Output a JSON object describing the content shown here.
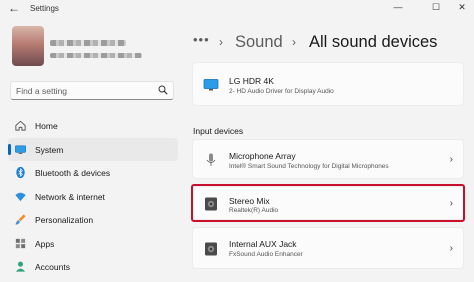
{
  "window": {
    "title": "Settings",
    "back_glyph": "←",
    "minimize_glyph": "—",
    "maximize_glyph": "☐",
    "close_glyph": "✕"
  },
  "search": {
    "placeholder": "Find a setting"
  },
  "nav": {
    "active_index": 1,
    "accent_color": "#0067c0",
    "items": [
      {
        "label": "Home",
        "icon": "home-icon"
      },
      {
        "label": "System",
        "icon": "system-icon"
      },
      {
        "label": "Bluetooth & devices",
        "icon": "bluetooth-icon"
      },
      {
        "label": "Network & internet",
        "icon": "wifi-icon"
      },
      {
        "label": "Personalization",
        "icon": "brush-icon"
      },
      {
        "label": "Apps",
        "icon": "apps-icon"
      },
      {
        "label": "Accounts",
        "icon": "accounts-icon"
      }
    ]
  },
  "breadcrumb": {
    "overflow": "•••",
    "separator": "›",
    "items": [
      "Sound",
      "All sound devices"
    ]
  },
  "output_devices": [
    {
      "name": "LG HDR 4K",
      "description": "2- HD Audio Driver for Display Audio",
      "icon": "monitor-icon"
    }
  ],
  "input_section_label": "Input devices",
  "input_devices": [
    {
      "name": "Microphone Array",
      "description": "Intel® Smart Sound Technology for Digital Microphones",
      "icon": "microphone-icon"
    },
    {
      "name": "Stereo Mix",
      "description": "Realtek(R) Audio",
      "icon": "speaker-icon",
      "highlighted": true
    },
    {
      "name": "Internal AUX Jack",
      "description": "FxSound Audio Enhancer",
      "icon": "speaker-icon"
    }
  ],
  "highlight_color": "#c8102e",
  "chevron_glyph": "›"
}
